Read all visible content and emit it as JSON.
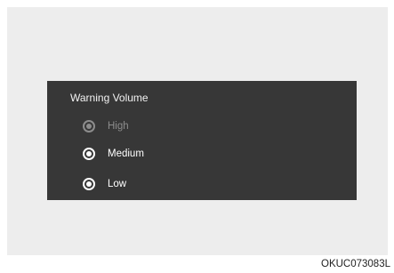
{
  "panel": {
    "title": "Warning Volume",
    "options": [
      {
        "label": "High",
        "state": "disabled"
      },
      {
        "label": "Medium",
        "state": "enabled"
      },
      {
        "label": "Low",
        "state": "enabled"
      }
    ]
  },
  "figure_code": "OKUC073083L",
  "colors": {
    "panel_background": "#373737",
    "frame_background": "#ededed",
    "text_primary": "#ffffff",
    "text_disabled": "#8d8d8d"
  }
}
